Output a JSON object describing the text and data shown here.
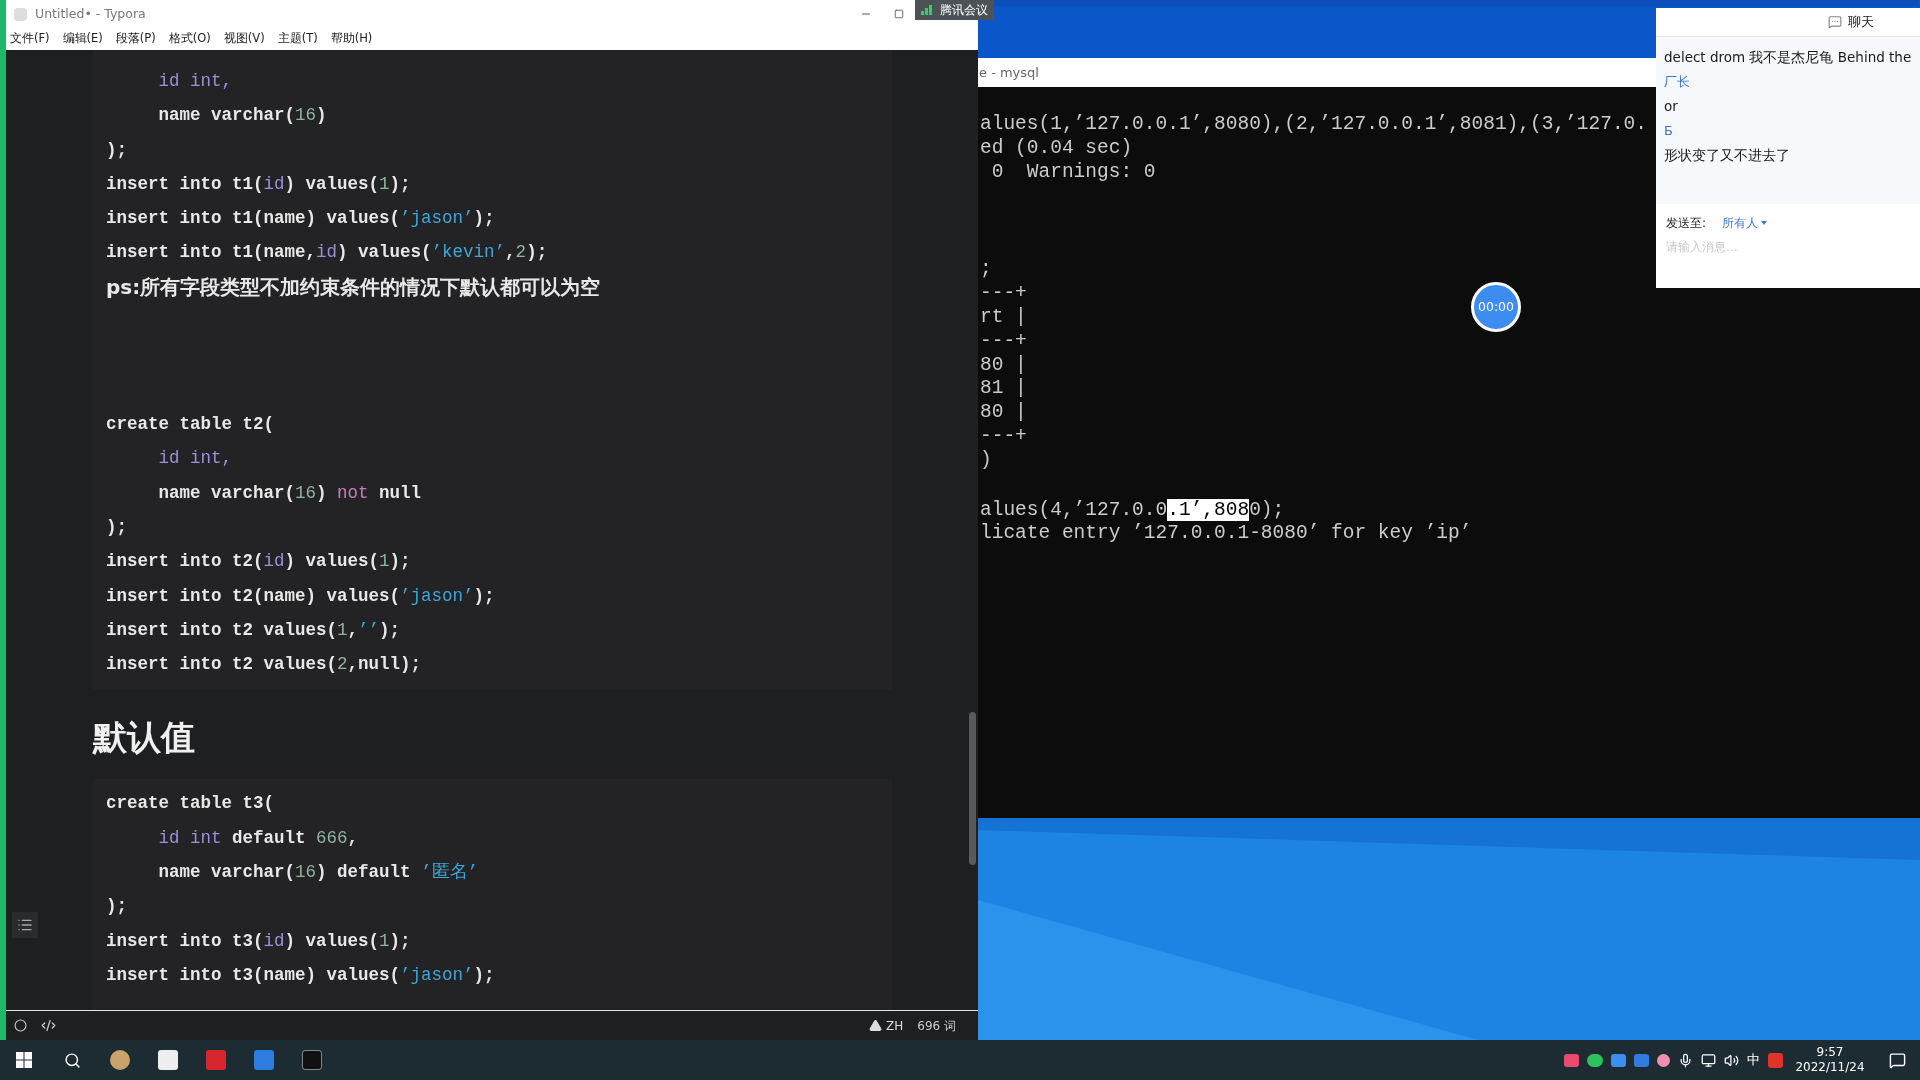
{
  "typora": {
    "title": "Untitled• - Typora",
    "menu": [
      "文件(F)",
      "编辑(E)",
      "段落(P)",
      "格式(O)",
      "视图(V)",
      "主题(T)",
      "帮助(H)"
    ],
    "blocks": [
      {
        "kind": "code",
        "lines": [
          {
            "kind": "code",
            "segments": [
              {
                "text": "     id int,",
                "kind": "var"
              }
            ]
          },
          {
            "kind": "code",
            "segments": [
              {
                "text": "     name varchar(",
                "kind": "plain"
              },
              {
                "text": "16",
                "kind": "num"
              },
              {
                "text": ")",
                "kind": "plain"
              }
            ]
          },
          {
            "kind": "code",
            "segments": [
              {
                "text": ");",
                "kind": "plain"
              }
            ]
          },
          {
            "kind": "code",
            "segments": [
              {
                "text": "insert into t1(",
                "kind": "plain"
              },
              {
                "text": "id",
                "kind": "var"
              },
              {
                "text": ") values(",
                "kind": "plain"
              },
              {
                "text": "1",
                "kind": "num"
              },
              {
                "text": ");",
                "kind": "plain"
              }
            ]
          },
          {
            "kind": "code",
            "segments": [
              {
                "text": "insert into t1(name) values(",
                "kind": "plain"
              },
              {
                "text": "’jason’",
                "kind": "str"
              },
              {
                "text": ");",
                "kind": "plain"
              }
            ]
          },
          {
            "kind": "code",
            "segments": [
              {
                "text": "insert into t1(name,",
                "kind": "plain"
              },
              {
                "text": "id",
                "kind": "var"
              },
              {
                "text": ") values(",
                "kind": "plain"
              },
              {
                "text": "’kevin’",
                "kind": "str"
              },
              {
                "text": ",",
                "kind": "plain"
              },
              {
                "text": "2",
                "kind": "num"
              },
              {
                "text": ");",
                "kind": "plain"
              }
            ]
          },
          {
            "kind": "note",
            "segments": [
              {
                "text": "ps:所有字段类型不加约束条件的情况下默认都可以为空",
                "kind": "plain"
              }
            ]
          },
          {
            "kind": "code",
            "segments": [
              {
                "text": "create table t2(",
                "kind": "plain"
              }
            ]
          },
          {
            "kind": "code",
            "segments": [
              {
                "text": "     id int,",
                "kind": "var"
              }
            ]
          },
          {
            "kind": "code",
            "segments": [
              {
                "text": "     name varchar(",
                "kind": "plain"
              },
              {
                "text": "16",
                "kind": "num"
              },
              {
                "text": ") ",
                "kind": "plain"
              },
              {
                "text": "not",
                "kind": "op"
              },
              {
                "text": " null",
                "kind": "plain"
              }
            ]
          },
          {
            "kind": "code",
            "segments": [
              {
                "text": ");",
                "kind": "plain"
              }
            ]
          },
          {
            "kind": "code",
            "segments": [
              {
                "text": "insert into t2(",
                "kind": "plain"
              },
              {
                "text": "id",
                "kind": "var"
              },
              {
                "text": ") values(",
                "kind": "plain"
              },
              {
                "text": "1",
                "kind": "num"
              },
              {
                "text": ");",
                "kind": "plain"
              }
            ]
          },
          {
            "kind": "code",
            "segments": [
              {
                "text": "insert into t2(name) values(",
                "kind": "plain"
              },
              {
                "text": "’jason’",
                "kind": "str"
              },
              {
                "text": ");",
                "kind": "plain"
              }
            ]
          },
          {
            "kind": "code",
            "segments": [
              {
                "text": "insert into t2 values(",
                "kind": "plain"
              },
              {
                "text": "1",
                "kind": "num"
              },
              {
                "text": ",",
                "kind": "plain"
              },
              {
                "text": "’’",
                "kind": "str"
              },
              {
                "text": ");",
                "kind": "plain"
              }
            ]
          },
          {
            "kind": "code",
            "segments": [
              {
                "text": "insert into t2 values(",
                "kind": "plain"
              },
              {
                "text": "2",
                "kind": "num"
              },
              {
                "text": ",null);",
                "kind": "plain"
              }
            ]
          }
        ]
      },
      {
        "kind": "heading",
        "text": "默认值"
      },
      {
        "kind": "code",
        "lines": [
          {
            "kind": "code",
            "segments": [
              {
                "text": "create table t3(",
                "kind": "plain"
              }
            ]
          },
          {
            "kind": "code",
            "segments": [
              {
                "text": "     id int",
                "kind": "var"
              },
              {
                "text": " default ",
                "kind": "plain"
              },
              {
                "text": "666",
                "kind": "num"
              },
              {
                "text": ",",
                "kind": "plain"
              }
            ]
          },
          {
            "kind": "code",
            "segments": [
              {
                "text": "     name varchar(",
                "kind": "plain"
              },
              {
                "text": "16",
                "kind": "num"
              },
              {
                "text": ") default ",
                "kind": "plain"
              },
              {
                "text": "’匿名’",
                "kind": "str"
              }
            ]
          },
          {
            "kind": "code",
            "segments": [
              {
                "text": ");",
                "kind": "plain"
              }
            ]
          },
          {
            "kind": "code",
            "segments": [
              {
                "text": "insert into t3(",
                "kind": "plain"
              },
              {
                "text": "id",
                "kind": "var"
              },
              {
                "text": ") values(",
                "kind": "plain"
              },
              {
                "text": "1",
                "kind": "num"
              },
              {
                "text": ");",
                "kind": "plain"
              }
            ]
          },
          {
            "kind": "code",
            "segments": [
              {
                "text": "insert into t3(name) values(",
                "kind": "plain"
              },
              {
                "text": "’jason’",
                "kind": "str"
              },
              {
                "text": ");",
                "kind": "plain"
              }
            ]
          }
        ]
      }
    ],
    "status": {
      "language": "ZH",
      "word_count": "696 词"
    }
  },
  "meeting_badge": "腾讯会议",
  "terminal": {
    "title": "e - mysql",
    "blocks": [
      [
        {
          "segments": [
            {
              "text": "alues(1,’127.0.0.1’,8080),(2,’127.0.0.1’,8081),(3,’127.0.",
              "highlighted": false
            }
          ]
        },
        {
          "segments": [
            {
              "text": "ed (0.04 sec)",
              "highlighted": false
            }
          ]
        },
        {
          "segments": [
            {
              "text": " 0  Warnings: 0",
              "highlighted": false
            }
          ]
        }
      ],
      [
        {
          "segments": [
            {
              "text": ";",
              "highlighted": false
            }
          ]
        },
        {
          "segments": [
            {
              "text": "---+",
              "highlighted": false
            }
          ]
        },
        {
          "segments": [
            {
              "text": "rt |",
              "highlighted": false
            }
          ]
        },
        {
          "segments": [
            {
              "text": "---+",
              "highlighted": false
            }
          ]
        },
        {
          "segments": [
            {
              "text": "80 |",
              "highlighted": false
            }
          ]
        },
        {
          "segments": [
            {
              "text": "81 |",
              "highlighted": false
            }
          ]
        },
        {
          "segments": [
            {
              "text": "80 |",
              "highlighted": false
            }
          ]
        },
        {
          "segments": [
            {
              "text": "---+",
              "highlighted": false
            }
          ]
        },
        {
          "segments": [
            {
              "text": ")",
              "highlighted": false
            }
          ]
        }
      ],
      [
        {
          "segments": [
            {
              "text": "alues(4,’127.0.0",
              "highlighted": false
            },
            {
              "text": ".1’,808",
              "highlighted": true
            },
            {
              "text": "0);",
              "highlighted": false
            }
          ]
        },
        {
          "segments": [
            {
              "text": "licate entry ’127.0.0.1-8080’ for key ’ip’",
              "highlighted": false
            }
          ]
        }
      ]
    ]
  },
  "timer": "00:00",
  "chat": {
    "title": "聊天",
    "messages": [
      {
        "kind": "message",
        "text": "delect drom 我不是杰尼龟 Behind the"
      },
      {
        "kind": "sender",
        "text": "厂长"
      },
      {
        "kind": "message",
        "text": "or"
      },
      {
        "kind": "sender",
        "text": "Б"
      },
      {
        "kind": "message",
        "text": "形状变了又不进去了"
      }
    ],
    "send_to_label": "发送至:",
    "recipient": "所有人",
    "placeholder": "请输入消息..."
  },
  "taskbar": {
    "ime": "中",
    "time": "9:57",
    "date": "2022/11/24"
  }
}
